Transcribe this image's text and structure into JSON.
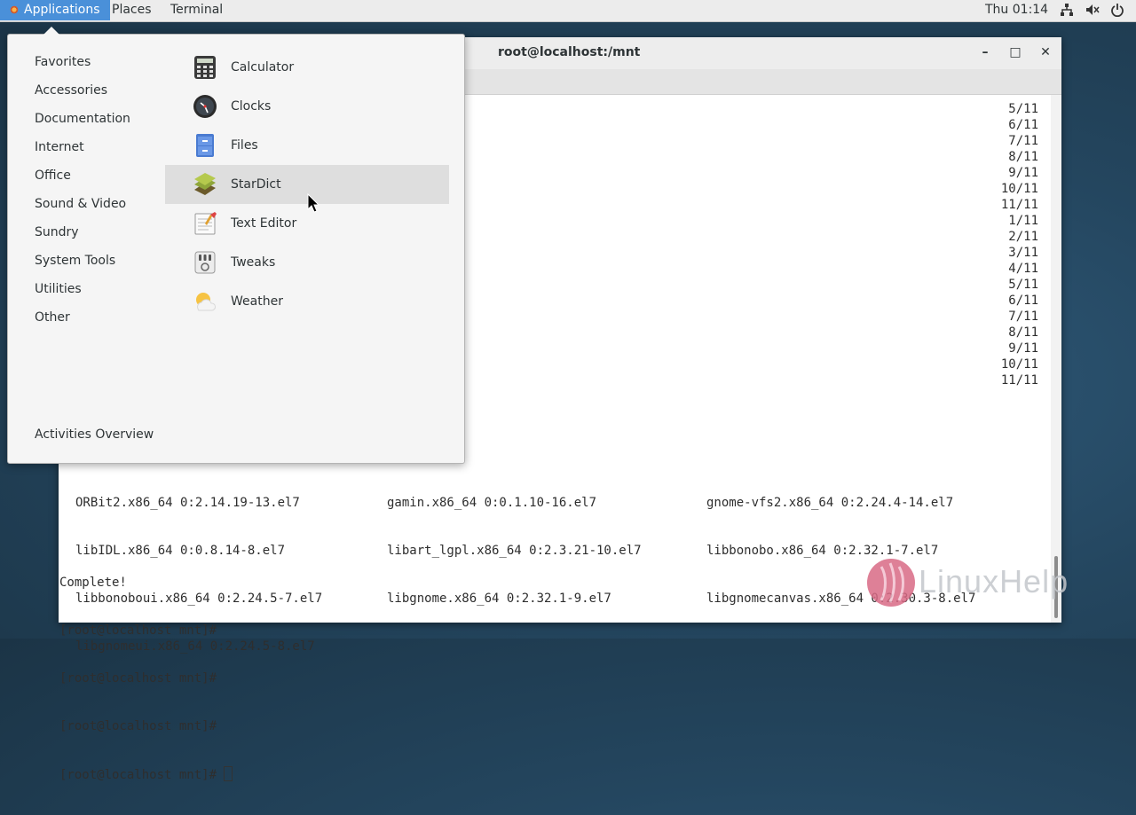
{
  "topbar": {
    "menus": [
      "Applications",
      "Places",
      "Terminal"
    ],
    "clock": "Thu 01:14",
    "tray_icons": [
      "network-icon",
      "volume-icon",
      "power-icon"
    ]
  },
  "terminal": {
    "title": "root@localhost:/mnt",
    "progress": [
      "5/11",
      "6/11",
      "7/11",
      "8/11",
      "9/11",
      "10/11",
      "11/11",
      "1/11",
      "2/11",
      "3/11",
      "4/11",
      "5/11",
      "6/11",
      "7/11",
      "8/11",
      "9/11",
      "10/11",
      "11/11"
    ],
    "packages": {
      "col1": [
        "ORBit2.x86_64 0:2.14.19-13.el7",
        "libIDL.x86_64 0:0.8.14-8.el7",
        "libbonoboui.x86_64 0:2.24.5-7.el7",
        "libgnomeui.x86_64 0:2.24.5-8.el7"
      ],
      "col2": [
        "gamin.x86_64 0:0.1.10-16.el7",
        "libart_lgpl.x86_64 0:2.3.21-10.el7",
        "libgnome.x86_64 0:2.32.1-9.el7"
      ],
      "col3": [
        "gnome-vfs2.x86_64 0:2.24.4-14.el7",
        "libbonobo.x86_64 0:2.32.1-7.el7",
        "libgnomecanvas.x86_64 0:2.30.3-8.el7"
      ]
    },
    "complete": "Complete!",
    "prompt": "[root@localhost mnt]#"
  },
  "app_menu": {
    "categories": [
      "Favorites",
      "Accessories",
      "Documentation",
      "Internet",
      "Office",
      "Sound & Video",
      "Sundry",
      "System Tools",
      "Utilities",
      "Other"
    ],
    "apps": [
      {
        "label": "Calculator",
        "icon": "calculator-icon"
      },
      {
        "label": "Clocks",
        "icon": "clock-icon"
      },
      {
        "label": "Files",
        "icon": "files-icon"
      },
      {
        "label": "StarDict",
        "icon": "stardict-icon"
      },
      {
        "label": "Text Editor",
        "icon": "text-editor-icon"
      },
      {
        "label": "Tweaks",
        "icon": "tweaks-icon"
      },
      {
        "label": "Weather",
        "icon": "weather-icon"
      }
    ],
    "activities": "Activities Overview"
  },
  "watermark": "LinuxHelp"
}
